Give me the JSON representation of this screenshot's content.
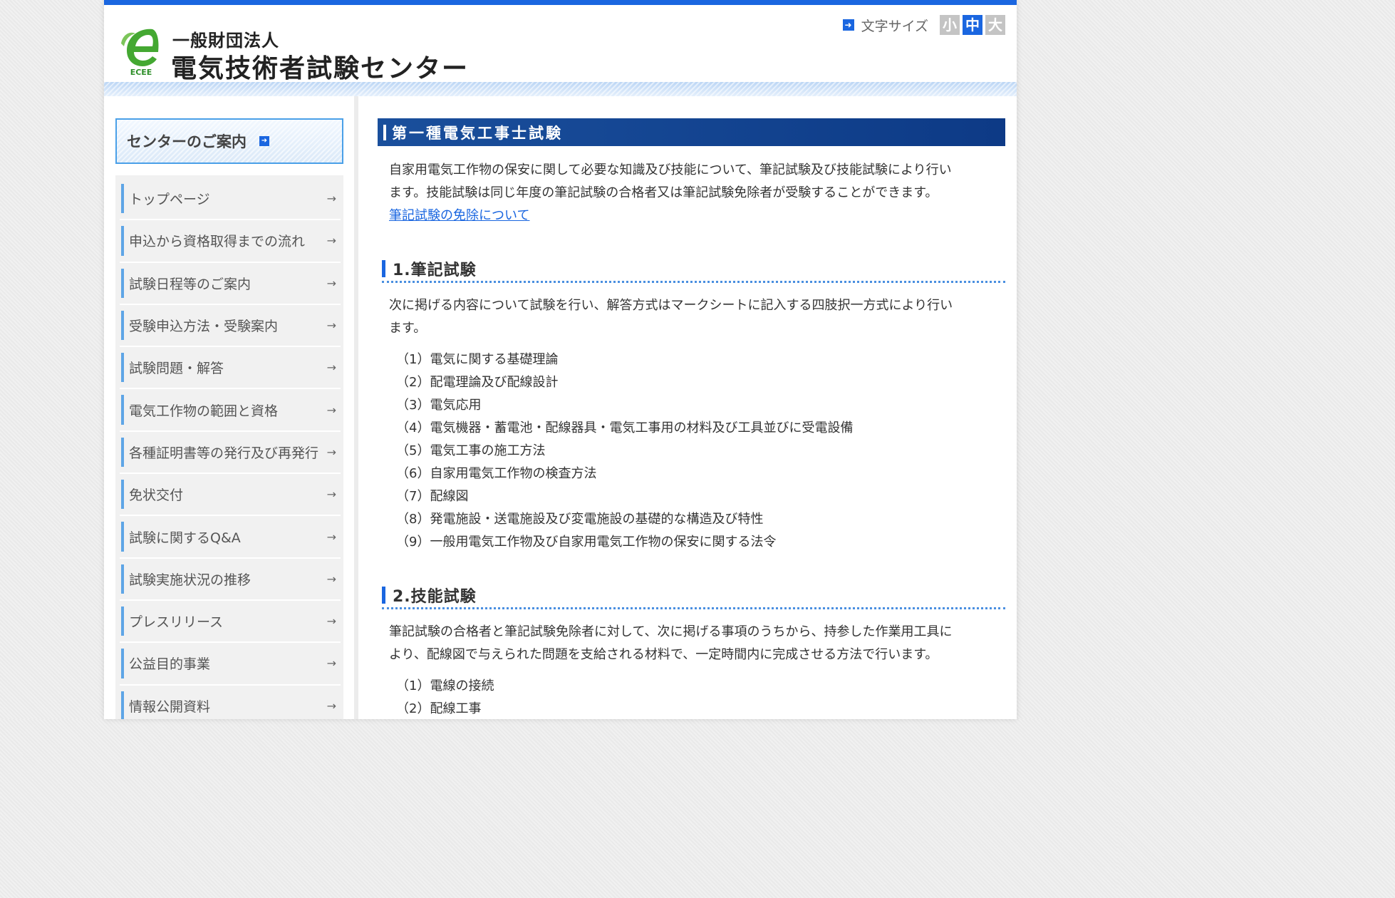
{
  "header": {
    "org_type": "一般財団法人",
    "org_name": "電気技術者試験センター",
    "logo_text": "ECEE",
    "font_size": {
      "label": "文字サイズ",
      "small": "小",
      "medium": "中",
      "large": "大",
      "selected": "medium"
    }
  },
  "sidebar": {
    "guide_title": "センターのご案内",
    "items": [
      {
        "label": "トップページ"
      },
      {
        "label": "申込から資格取得までの流れ"
      },
      {
        "label": "試験日程等のご案内"
      },
      {
        "label": "受験申込方法・受験案内"
      },
      {
        "label": "試験問題・解答"
      },
      {
        "label": "電気工作物の範囲と資格"
      },
      {
        "label": "各種証明書等の発行及び再発行"
      },
      {
        "label": "免状交付"
      },
      {
        "label": "試験に関するQ&A"
      },
      {
        "label": "試験実施状況の推移"
      },
      {
        "label": "プレスリリース"
      },
      {
        "label": "公益目的事業"
      },
      {
        "label": "情報公開資料"
      }
    ],
    "arrow": "→"
  },
  "main": {
    "title": "第一種電気工事士試験",
    "intro_line1": "自家用電気工作物の保安に関して必要な知識及び技能について、筆記試験及び技能試験により行い",
    "intro_line2": "ます。技能試験は同じ年度の筆記試験の合格者又は筆記試験免除者が受験することができます。",
    "exemption_link": "筆記試験の免除について",
    "section1": {
      "title": "1.筆記試験",
      "desc_line1": "次に掲げる内容について試験を行い、解答方式はマークシートに記入する四肢択一方式により行い",
      "desc_line2": "ます。",
      "items": [
        "（1）電気に関する基礎理論",
        "（2）配電理論及び配線設計",
        "（3）電気応用",
        "（4）電気機器・蓄電池・配線器具・電気工事用の材料及び工具並びに受電設備",
        "（5）電気工事の施工方法",
        "（6）自家用電気工作物の検査方法",
        "（7）配線図",
        "（8）発電施設・送電施設及び変電施設の基礎的な構造及び特性",
        "（9）一般用電気工作物及び自家用電気工作物の保安に関する法令"
      ]
    },
    "section2": {
      "title": "2.技能試験",
      "desc_line1": "筆記試験の合格者と筆記試験免除者に対して、次に掲げる事項のうちから、持参した作業用工具に",
      "desc_line2": "より、配線図で与えられた問題を支給される材料で、一定時間内に完成させる方法で行います。",
      "items": [
        "（1）電線の接続",
        "（2）配線工事"
      ]
    }
  }
}
